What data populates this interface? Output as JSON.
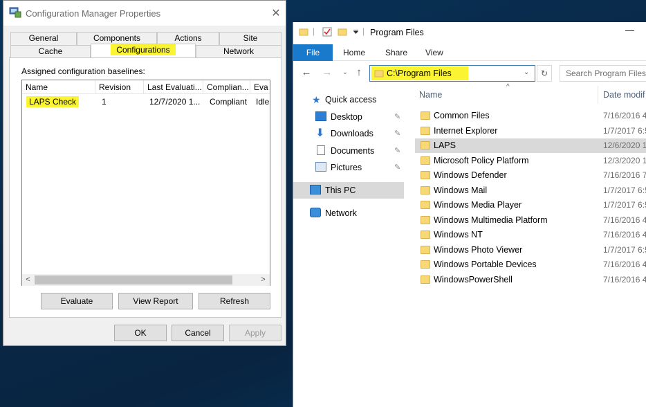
{
  "config_manager": {
    "title": "Configuration Manager Properties",
    "close_glyph": "✕",
    "tabs_row1": [
      "General",
      "Components",
      "Actions",
      "Site"
    ],
    "tabs_row2": [
      "Cache",
      "Configurations",
      "Network"
    ],
    "active_tab": "Configurations",
    "group_label": "Assigned configuration baselines:",
    "columns": [
      "Name",
      "Revision",
      "Last Evaluati...",
      "Complian...",
      "Eva"
    ],
    "rows": [
      {
        "name": "LAPS Check",
        "revision": "1",
        "last_evaluation": "12/7/2020 1...",
        "compliance": "Compliant",
        "evaluation": "Idle"
      }
    ],
    "scroll_left": "<",
    "scroll_right": ">",
    "buttons": {
      "evaluate": "Evaluate",
      "view_report": "View Report",
      "refresh": "Refresh"
    },
    "footer_buttons": {
      "ok": "OK",
      "cancel": "Cancel",
      "apply": "Apply"
    }
  },
  "explorer": {
    "title": "Program Files",
    "minimize_glyph": "—",
    "ribbon_tabs": [
      "File",
      "Home",
      "Share",
      "View"
    ],
    "address": "C:\\Program Files",
    "search_placeholder": "Search Program Files",
    "columns": {
      "name": "Name",
      "date": "Date modif"
    },
    "sort_glyph": "^",
    "nav": {
      "quick_access": "Quick access",
      "items": [
        "Desktop",
        "Downloads",
        "Documents",
        "Pictures"
      ],
      "this_pc": "This PC",
      "network": "Network"
    },
    "files": [
      {
        "name": "Common Files",
        "date": "7/16/2016 4"
      },
      {
        "name": "Internet Explorer",
        "date": "1/7/2017 6:5"
      },
      {
        "name": "LAPS",
        "date": "12/6/2020 1"
      },
      {
        "name": "Microsoft Policy Platform",
        "date": "12/3/2020 1"
      },
      {
        "name": "Windows Defender",
        "date": "7/16/2016 7"
      },
      {
        "name": "Windows Mail",
        "date": "1/7/2017 6:5"
      },
      {
        "name": "Windows Media Player",
        "date": "1/7/2017 6:5"
      },
      {
        "name": "Windows Multimedia Platform",
        "date": "7/16/2016 4"
      },
      {
        "name": "Windows NT",
        "date": "7/16/2016 4"
      },
      {
        "name": "Windows Photo Viewer",
        "date": "1/7/2017 6:5"
      },
      {
        "name": "Windows Portable Devices",
        "date": "7/16/2016 4"
      },
      {
        "name": "WindowsPowerShell",
        "date": "7/16/2016 4"
      }
    ],
    "selected_file": "LAPS"
  },
  "colors": {
    "highlight": "#fbf432",
    "file_tab": "#1979ca",
    "folder": "#f8d775",
    "selection": "#d9d9d9"
  }
}
